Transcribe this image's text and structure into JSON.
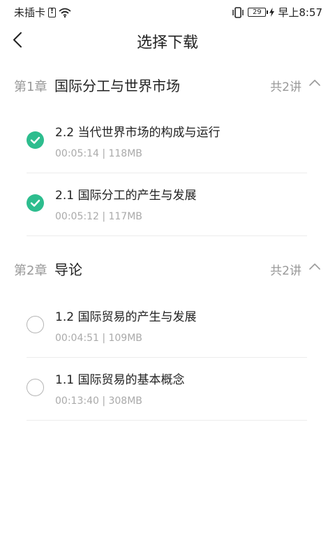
{
  "status": {
    "carrier": "未插卡",
    "battery": "29",
    "time": "早上8:57"
  },
  "header": {
    "title": "选择下载"
  },
  "chapters": [
    {
      "num": "第1章",
      "title": "国际分工与世界市场",
      "count": "共2讲",
      "lessons": [
        {
          "title": "2.2 当代世界市场的构成与运行",
          "meta": "00:05:14 | 118MB",
          "selected": true
        },
        {
          "title": "2.1 国际分工的产生与发展",
          "meta": "00:05:12 | 117MB",
          "selected": true
        }
      ]
    },
    {
      "num": "第2章",
      "title": "导论",
      "count": "共2讲",
      "lessons": [
        {
          "title": "1.2 国际贸易的产生与发展",
          "meta": "00:04:51 | 109MB",
          "selected": false
        },
        {
          "title": "1.1 国际贸易的基本概念",
          "meta": "00:13:40 | 308MB",
          "selected": false
        }
      ]
    }
  ],
  "colors": {
    "accent": "#2dbd8e"
  }
}
